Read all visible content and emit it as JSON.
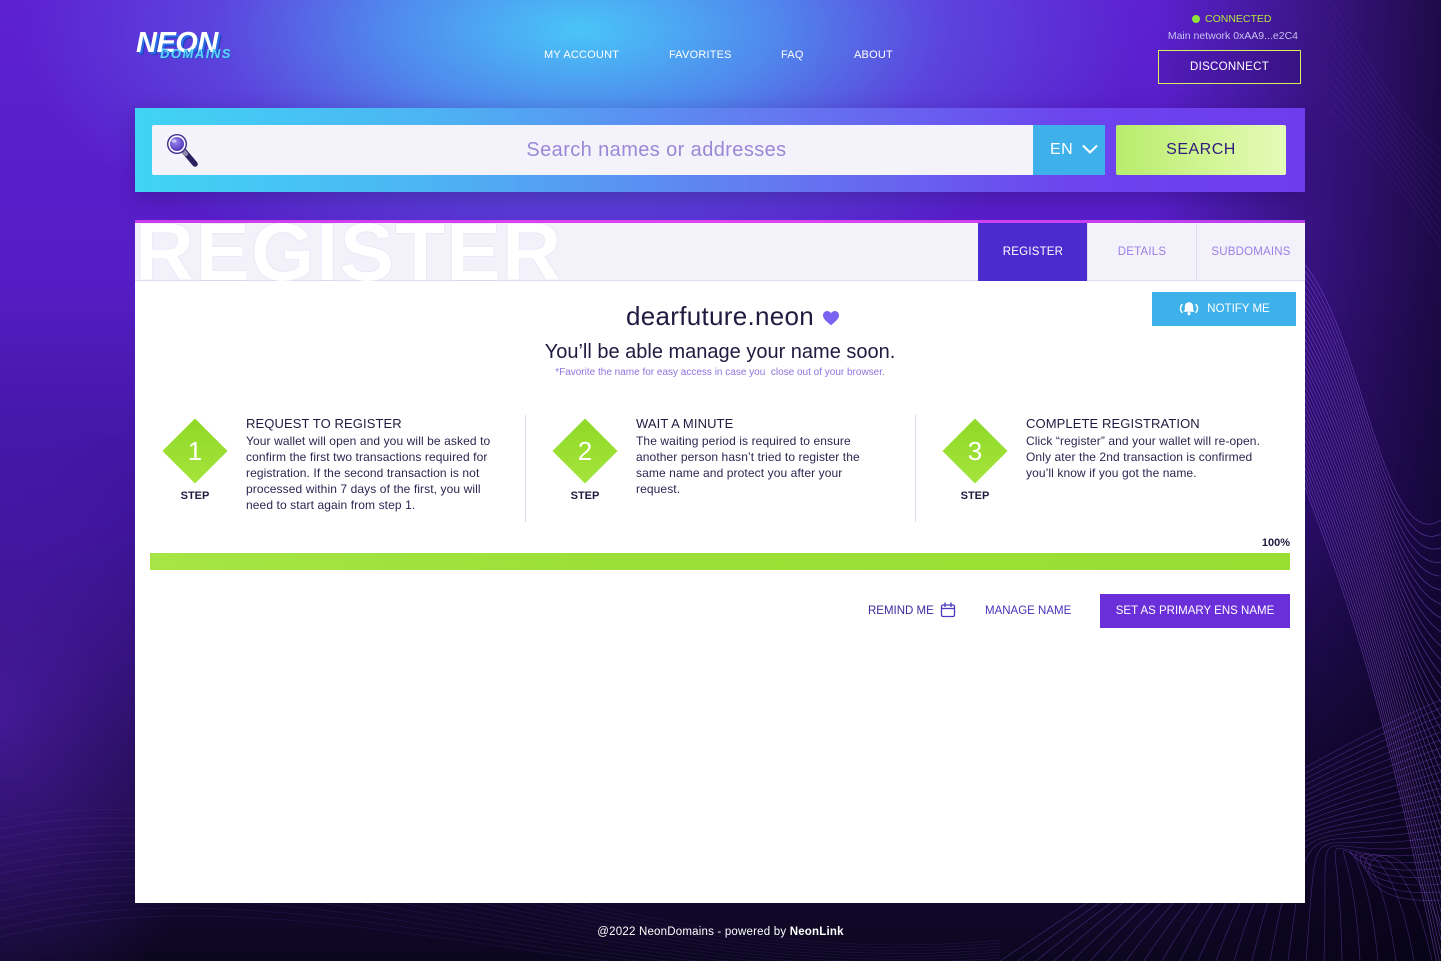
{
  "app": {
    "logo": {
      "primary": "NEON",
      "secondary": "DOMAINS"
    }
  },
  "nav": {
    "items": [
      {
        "label": "MY ACCOUNT"
      },
      {
        "label": "FAVORITES"
      },
      {
        "label": "FAQ"
      },
      {
        "label": "ABOUT"
      }
    ]
  },
  "wallet": {
    "status": "CONNECTED",
    "network": "Main network 0xAA9...e2C4",
    "disconnect_label": "DISCONNECT"
  },
  "search": {
    "placeholder": "Search names or addresses",
    "value": "",
    "language": "EN",
    "button_label": "SEARCH"
  },
  "card": {
    "watermark": "REGISTER",
    "tabs": [
      {
        "label": "REGISTER",
        "active": true
      },
      {
        "label": "DETAILS",
        "active": false
      },
      {
        "label": "SUBDOMAINS",
        "active": false
      }
    ],
    "notify_label": "NOTIFY ME",
    "domain_name": "dearfuture.neon",
    "headline": "You’ll be able manage your name soon.",
    "note": "*Favorite the name for easy access in case you  close out of your browser.",
    "steps": [
      {
        "number": "1",
        "step_label": "STEP",
        "title": "REQUEST TO REGISTER",
        "description_lines": [
          "Your wallet will open and you will be asked to",
          "confirm the first two transactions required for",
          "registration. If the second transaction is not",
          "processed within 7 days of the first, you will",
          "need to start again from step 1."
        ]
      },
      {
        "number": "2",
        "step_label": "STEP",
        "title": "WAIT A MINUTE",
        "description_lines": [
          "The waiting period is required to ensure",
          "another person hasn’t tried to register the",
          "same name and protect you after your",
          "request."
        ]
      },
      {
        "number": "3",
        "step_label": "STEP",
        "title": "COMPLETE REGISTRATION",
        "description_lines": [
          "Click “register” and your wallet will re-open.",
          "Only ater the 2nd transaction is confirmed",
          "you’ll know if you got the name."
        ]
      }
    ],
    "progress": {
      "label": "100%",
      "percent": 100
    },
    "actions": {
      "remind_label": "REMIND ME",
      "manage_label": "MANAGE NAME",
      "primary_label": "SET AS PRIMARY ENS NAME"
    }
  },
  "footer": {
    "prefix": "@2022 NeonDomains - powered by ",
    "brand": "NeonLink"
  },
  "colors": {
    "brand_purple": "#4b2bce",
    "button_purple": "#6a2fd8",
    "cyan": "#3eb1ea",
    "lime": "#96dc2e",
    "connected_green": "#8fe03a",
    "magenta_accent": "#d23ef2",
    "text_dark": "#1f1b40",
    "text_link_purple": "#3b2a9e"
  },
  "icons": {
    "search": "magnifier-icon",
    "language_dropdown": "chevron-down-icon",
    "favorite": "heart-icon",
    "notify": "bell-icon",
    "remind": "calendar-icon",
    "status": "status-dot-icon"
  }
}
